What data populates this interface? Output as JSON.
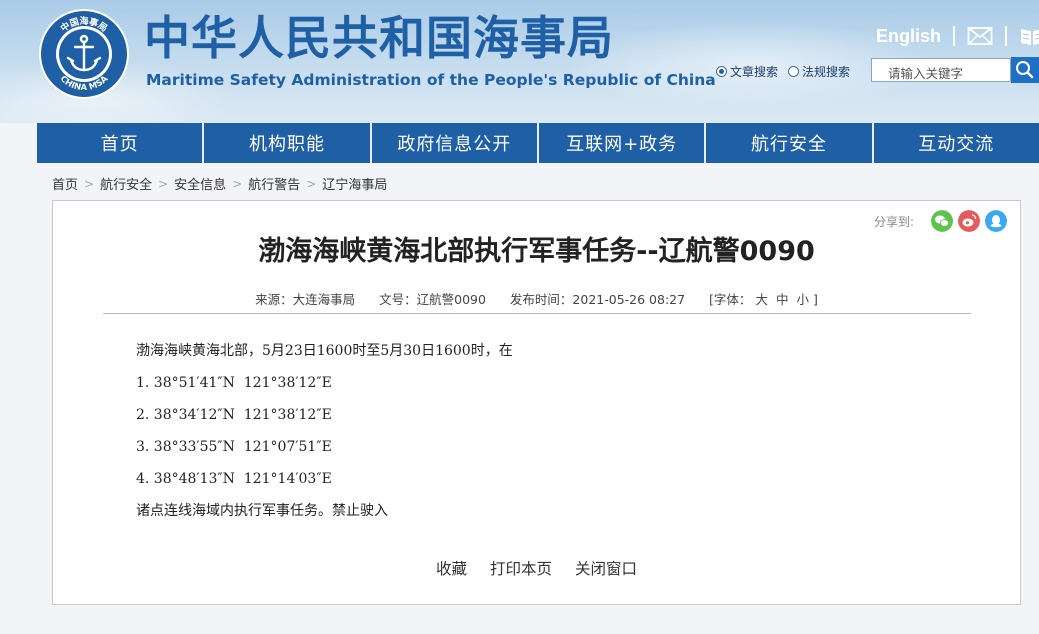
{
  "header": {
    "title_cn": "中华人民共和国海事局",
    "title_en": "Maritime Safety Administration of the People's Republic of China",
    "logo_text_top": "中国海事局",
    "logo_text_bottom": "CHINA MSA",
    "english_link": "English",
    "search": {
      "options": [
        "文章搜索",
        "法规搜索"
      ],
      "selected": "文章搜索",
      "placeholder": "请输入关键字"
    }
  },
  "nav": {
    "items": [
      "首页",
      "机构职能",
      "政府信息公开",
      "互联网+政务",
      "航行安全",
      "互动交流"
    ]
  },
  "breadcrumb": [
    "首页",
    "航行安全",
    "安全信息",
    "航行警告",
    "辽宁海事局"
  ],
  "article": {
    "share_label": "分享到:",
    "title": "渤海海峡黄海北部执行军事任务--辽航警0090",
    "meta": {
      "source": "来源：大连海事局",
      "doc_no": "文号：辽航警0090",
      "published": "发布时间：2021-05-26 08:27",
      "font_label": "[字体：",
      "font_sizes": [
        "大",
        "中",
        "小"
      ],
      "font_close": "]"
    },
    "lines": [
      "渤海海峡黄海北部，5月23日1600时至5月30日1600时，在",
      "1. 38°51′41″N  121°38′12″E",
      "2. 38°34′12″N  121°38′12″E",
      "3. 38°33′55″N  121°07′51″E",
      "4. 38°48′13″N  121°14′03″E",
      "诸点连线海域内执行军事任务。禁止驶入"
    ],
    "actions": [
      "收藏",
      "打印本页",
      "关闭窗口"
    ]
  },
  "colors": {
    "brand_blue": "#1f5fa6",
    "wechat": "#5cc34c",
    "weibo": "#e65a5a",
    "qq": "#3aa8f2"
  }
}
